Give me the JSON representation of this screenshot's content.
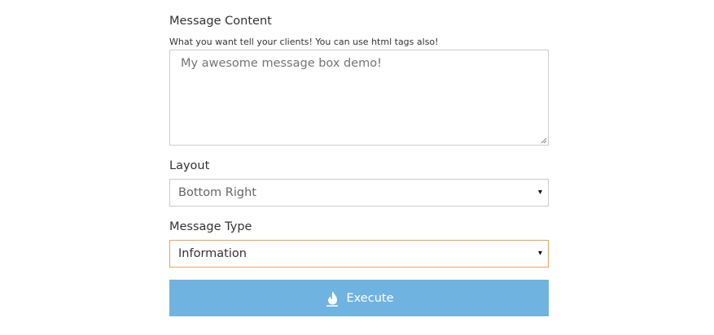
{
  "message_content": {
    "label": "Message Content",
    "help": "What you want tell your clients! You can use html tags also!",
    "value": "My awesome message box demo!"
  },
  "layout": {
    "label": "Layout",
    "selected": "Bottom Right",
    "caret": "▾"
  },
  "message_type": {
    "label": "Message Type",
    "selected": "Information",
    "caret": "▾"
  },
  "execute_button": {
    "label": "Execute",
    "icon": "fire-icon"
  },
  "colors": {
    "button_bg": "#6fb3e0",
    "focus_border": "#e8a25a",
    "input_border": "#cccccc"
  }
}
